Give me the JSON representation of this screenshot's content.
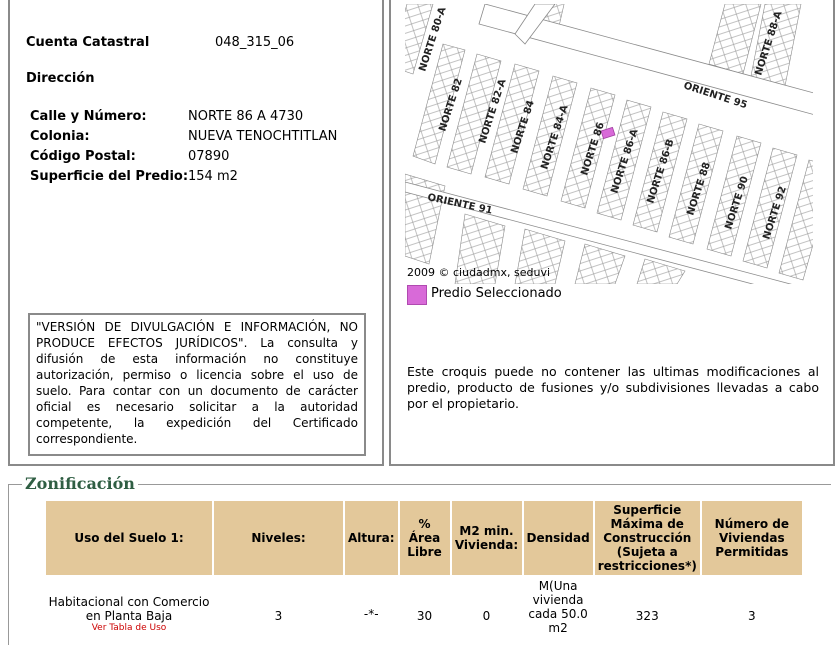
{
  "property": {
    "account_label": "Cuenta Catastral",
    "account_value": "048_315_06",
    "address_heading": "Dirección",
    "street_label": "Calle y Número:",
    "street_value": "NORTE 86 A 4730",
    "colonia_label": "Colonia:",
    "colonia_value": "NUEVA TENOCHTITLAN",
    "postal_label": "Código Postal:",
    "postal_value": "07890",
    "area_label": "Superficie del Predio:",
    "area_value": "154 m2"
  },
  "disclaimer": "\"VERSIÓN DE DIVULGACIÓN E INFORMACIÓN, NO PRODUCE EFECTOS JURÍDICOS\". La consulta y difusión de esta información no constituye autorización, permiso o licencia sobre el uso de suelo. Para contar con un documento de carácter oficial es necesario solicitar a la autoridad competente, la expedición del Certificado correspondiente.",
  "map": {
    "copyright": "2009 © ciudadmx, seduvi",
    "legend_label": "Predio Seleccionado",
    "legend_color": "#d86ad8",
    "streets": [
      "NORTE 80-A",
      "NORTE 82",
      "NORTE 82-A",
      "NORTE 84",
      "NORTE 84-A",
      "NORTE 86",
      "NORTE 86-A",
      "NORTE 86-B",
      "NORTE 88",
      "NORTE 90",
      "NORTE 92",
      "NORTE 88-A",
      "ORIENTE 95",
      "ORIENTE 91"
    ],
    "note": "Este croquis puede no contener las ultimas modificaciones al predio, producto de fusiones y/o subdivisiones llevadas a cabo por el propietario."
  },
  "zonificacion": {
    "title": "Zonificación",
    "headers": [
      "Uso del Suelo 1:",
      "Niveles:",
      "Altura:",
      "% Área Libre",
      "M2 min. Vivienda:",
      "Densidad",
      "Superficie Máxima de Construcción (Sujeta a restricciones*)",
      "Número de Viviendas Permitidas"
    ],
    "row": [
      "Habitacional con Comercio en Planta Baja",
      "3",
      "-*-",
      "30",
      "0",
      "M(Una vivienda cada 50.0 m2",
      "323",
      "3"
    ],
    "row_link": "Ver Tabla de Uso"
  }
}
